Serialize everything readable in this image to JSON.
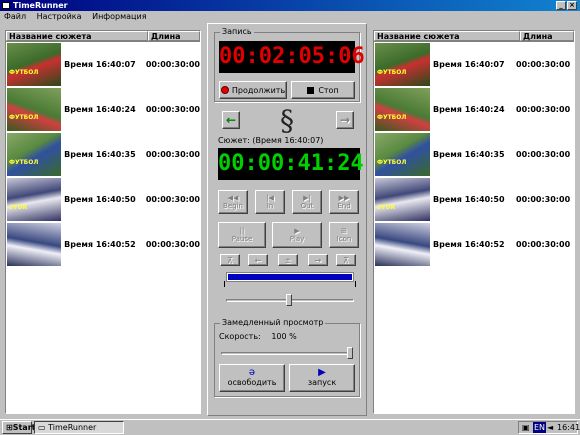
{
  "window": {
    "title": "TimeRunner",
    "btn_min": "_",
    "btn_close": "×"
  },
  "menu": [
    "Файл",
    "Настройка",
    "Информация"
  ],
  "list_headers": {
    "name": "Название сюжета",
    "duration": "Длина"
  },
  "left_rows": [
    {
      "time": "Время 16:40:07",
      "dur": "00:00:30:00",
      "logo": "ФУТБОЛ"
    },
    {
      "time": "Время 16:40:24",
      "dur": "00:00:30:00",
      "logo": "ФУТБОЛ"
    },
    {
      "time": "Время 16:40:35",
      "dur": "00:00:30:00",
      "logo": "ФУТБОЛ"
    },
    {
      "time": "Время 16:40:50",
      "dur": "00:00:30:00",
      "logo": "STOR"
    },
    {
      "time": "Время 16:40:52",
      "dur": "00:00:30:00",
      "logo": ""
    }
  ],
  "right_rows": [
    {
      "time": "Время 16:40:07",
      "dur": "00:00:30:00",
      "logo": "ФУТБОЛ"
    },
    {
      "time": "Время 16:40:24",
      "dur": "00:00:30:00",
      "logo": "ФУТБОЛ"
    },
    {
      "time": "Время 16:40:35",
      "dur": "00:00:30:00",
      "logo": "ФУТБОЛ"
    },
    {
      "time": "Время 16:40:50",
      "dur": "00:00:30:00",
      "logo": "STOR"
    },
    {
      "time": "Время 16:40:52",
      "dur": "00:00:30:00",
      "logo": ""
    }
  ],
  "record": {
    "label": "Запись",
    "timecode": "00:02:05:06",
    "continue": "Продолжить",
    "stop": "Стоп"
  },
  "nav": {
    "left": "←",
    "right": "→"
  },
  "clip": {
    "label": "Сюжет: (Время 16:40:07)",
    "timecode": "00:00:41:24"
  },
  "transport": {
    "begin": "Begin",
    "in": "In",
    "out": "Out",
    "end": "End",
    "pause": "Pause",
    "play": "Play",
    "icon": "Icon"
  },
  "slow": {
    "label": "Замедленный просмотр",
    "speed_label": "Скорость:",
    "speed_value": "100",
    "speed_unit": "%",
    "release": "освободить",
    "start": "запуск"
  },
  "taskbar": {
    "start": "Start",
    "app": "TimeRunner",
    "lang": "EN",
    "clock": "16:41"
  },
  "colors": {
    "titlebar": "#000080",
    "lcd_red": "#e00000",
    "lcd_green": "#00d000",
    "accent_blue": "#0000c0"
  }
}
